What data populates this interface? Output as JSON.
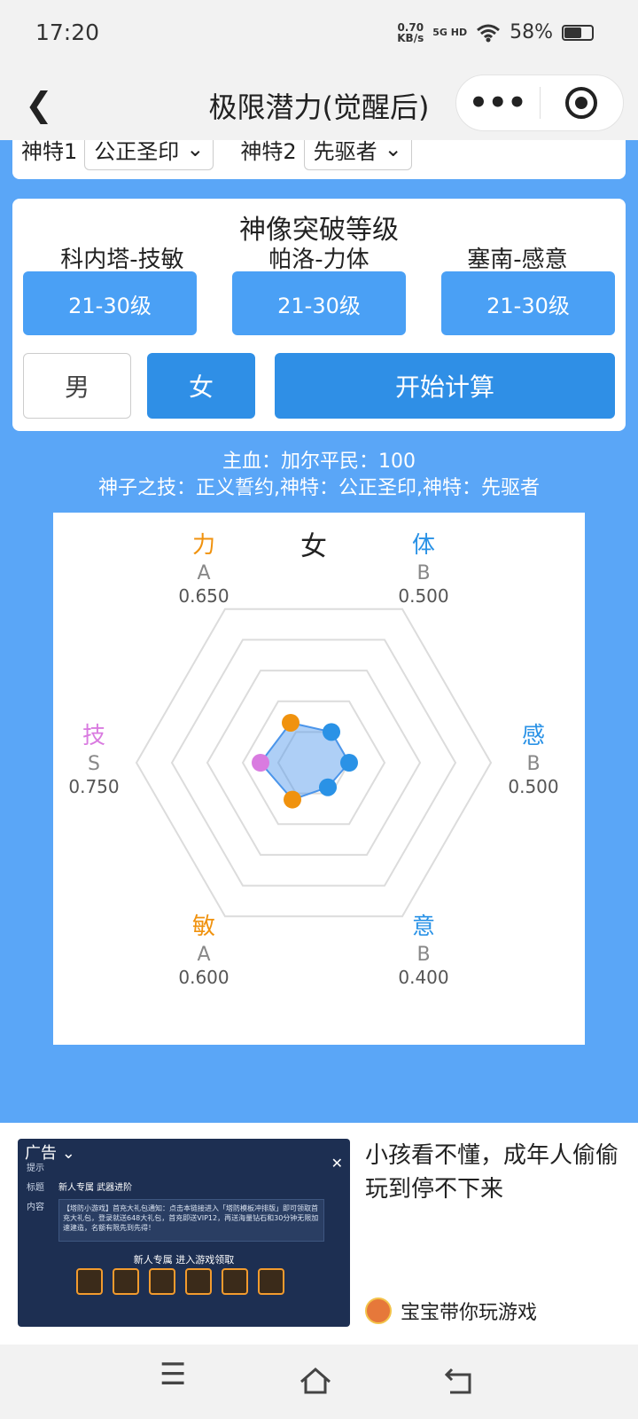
{
  "status": {
    "time": "17:20",
    "netspeed_value": "0.70",
    "netspeed_unit": "KB/s",
    "signal": "5G HD",
    "battery": "58%"
  },
  "nav": {
    "title": "极限潜力(觉醒后)",
    "more_icon": "more-icon",
    "target_icon": "target-icon"
  },
  "selectors": [
    {
      "label": "神特1",
      "value": "公正圣印"
    },
    {
      "label": "神特2",
      "value": "先驱者"
    }
  ],
  "breakthrough": {
    "title": "神像突破等级",
    "gods": [
      {
        "label": "科内塔-技敏",
        "level": "21-30级"
      },
      {
        "label": "帕洛-力体",
        "level": "21-30级"
      },
      {
        "label": "塞南-感意",
        "level": "21-30级"
      }
    ]
  },
  "gender": {
    "male": "男",
    "female": "女",
    "selected": "female"
  },
  "calc_button": "开始计算",
  "info": {
    "line1": "主血：加尔平民：100",
    "line2": "神子之技：正义誓约,神特：公正圣印,神特：先驱者"
  },
  "chart_data": {
    "type": "radar",
    "title": "女",
    "axes": [
      {
        "name": "力",
        "grade": "A",
        "value": 0.65,
        "color": "#f0920e"
      },
      {
        "name": "体",
        "grade": "B",
        "value": 0.5,
        "color": "#2a92e6"
      },
      {
        "name": "感",
        "grade": "B",
        "value": 0.5,
        "color": "#2a92e6"
      },
      {
        "name": "意",
        "grade": "B",
        "value": 0.4,
        "color": "#2a92e6"
      },
      {
        "name": "敏",
        "grade": "A",
        "value": 0.6,
        "color": "#f0920e"
      },
      {
        "name": "技",
        "grade": "S",
        "value": 0.75,
        "color": "#d97be0"
      }
    ],
    "value_labels": [
      "0.650",
      "0.500",
      "0.500",
      "0.400",
      "0.600",
      "0.750"
    ],
    "range": [
      0,
      2.5
    ],
    "rings": 5,
    "fill_color": "#4b95ea"
  },
  "ad": {
    "tag": "广告",
    "dialog_header": "提示",
    "title_label": "标题",
    "title_value": "新人专属 武器进阶",
    "content_label": "内容",
    "content_value": "【塔防小游戏】首充大礼包通知：点击本链接进入「塔防模板冲排版」即可领取首充大礼包，登录就送648大礼包，首充即送VIP12，再送海量钻石和30分钟无限加速建造，名额有限先到先得！",
    "promo": "新人专属 进入游戏领取",
    "text": "小孩看不懂，成年人偷偷玩到停不下来",
    "author": "宝宝带你玩游戏"
  },
  "bottom": {
    "menu_icon": "menu-icon",
    "home_icon": "home-icon",
    "back_icon": "back-icon"
  }
}
